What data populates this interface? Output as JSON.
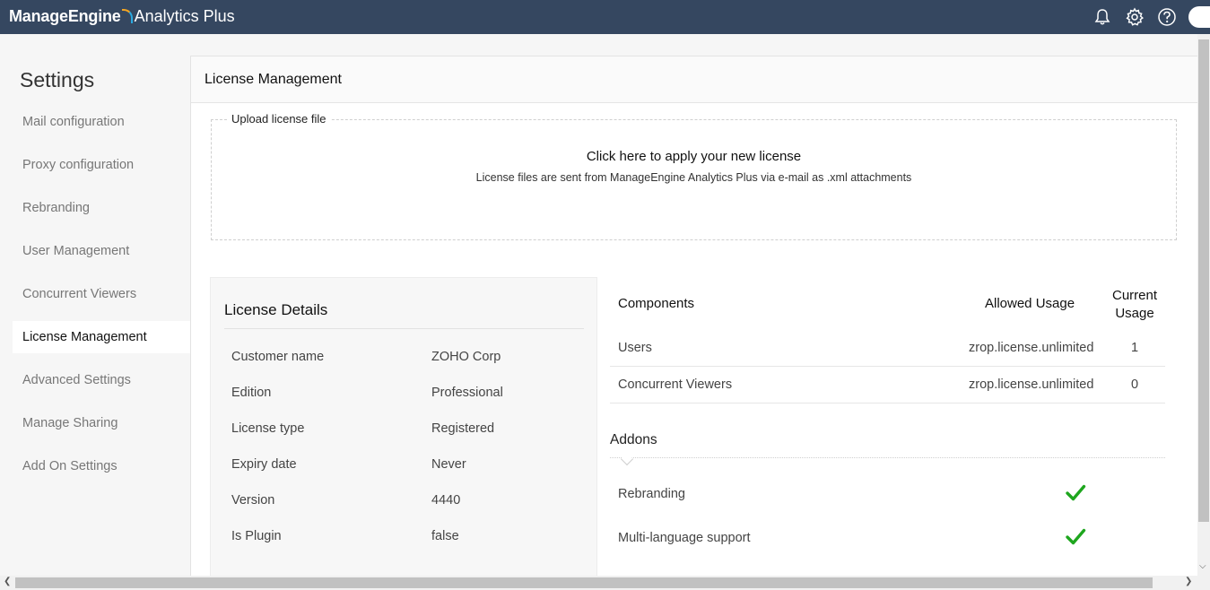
{
  "brand": {
    "part1": "ManageEngine",
    "part2": "Analytics Plus"
  },
  "topbar_icons": [
    "bell-icon",
    "gear-icon",
    "help-icon",
    "avatar"
  ],
  "sidebar": {
    "title": "Settings",
    "items": [
      {
        "label": "Mail configuration",
        "active": false
      },
      {
        "label": "Proxy configuration",
        "active": false
      },
      {
        "label": "Rebranding",
        "active": false
      },
      {
        "label": "User Management",
        "active": false
      },
      {
        "label": "Concurrent Viewers",
        "active": false
      },
      {
        "label": "License Management",
        "active": true
      },
      {
        "label": "Advanced Settings",
        "active": false
      },
      {
        "label": "Manage Sharing",
        "active": false
      },
      {
        "label": "Add On Settings",
        "active": false
      }
    ]
  },
  "main": {
    "title": "License Management",
    "upload": {
      "legend": "Upload license file",
      "title": "Click here to apply your new license",
      "subtitle": "License files are sent from ManageEngine Analytics Plus via e-mail as .xml attachments"
    },
    "details": {
      "title": "License Details",
      "rows": [
        {
          "key": "Customer name",
          "value": "ZOHO Corp"
        },
        {
          "key": "Edition",
          "value": "Professional"
        },
        {
          "key": "License type",
          "value": "Registered"
        },
        {
          "key": "Expiry date",
          "value": "Never"
        },
        {
          "key": "Version",
          "value": "4440"
        },
        {
          "key": "Is Plugin",
          "value": "false"
        }
      ]
    },
    "components": {
      "headers": {
        "component": "Components",
        "allowed": "Allowed Usage",
        "current_line1": "Current",
        "current_line2": "Usage"
      },
      "rows": [
        {
          "name": "Users",
          "allowed": "zrop.license.unlimited",
          "current": "1"
        },
        {
          "name": "Concurrent Viewers",
          "allowed": "zrop.license.unlimited",
          "current": "0"
        }
      ]
    },
    "addons": {
      "title": "Addons",
      "rows": [
        {
          "name": "Rebranding",
          "enabled_icon": "checkmark-icon"
        },
        {
          "name": "Multi-language support",
          "enabled_icon": "checkmark-icon"
        }
      ]
    }
  },
  "colors": {
    "topbar": "#354760",
    "check": "#1ea61e",
    "brand_orange": "#f4a623",
    "brand_blue": "#2aa9e0"
  }
}
